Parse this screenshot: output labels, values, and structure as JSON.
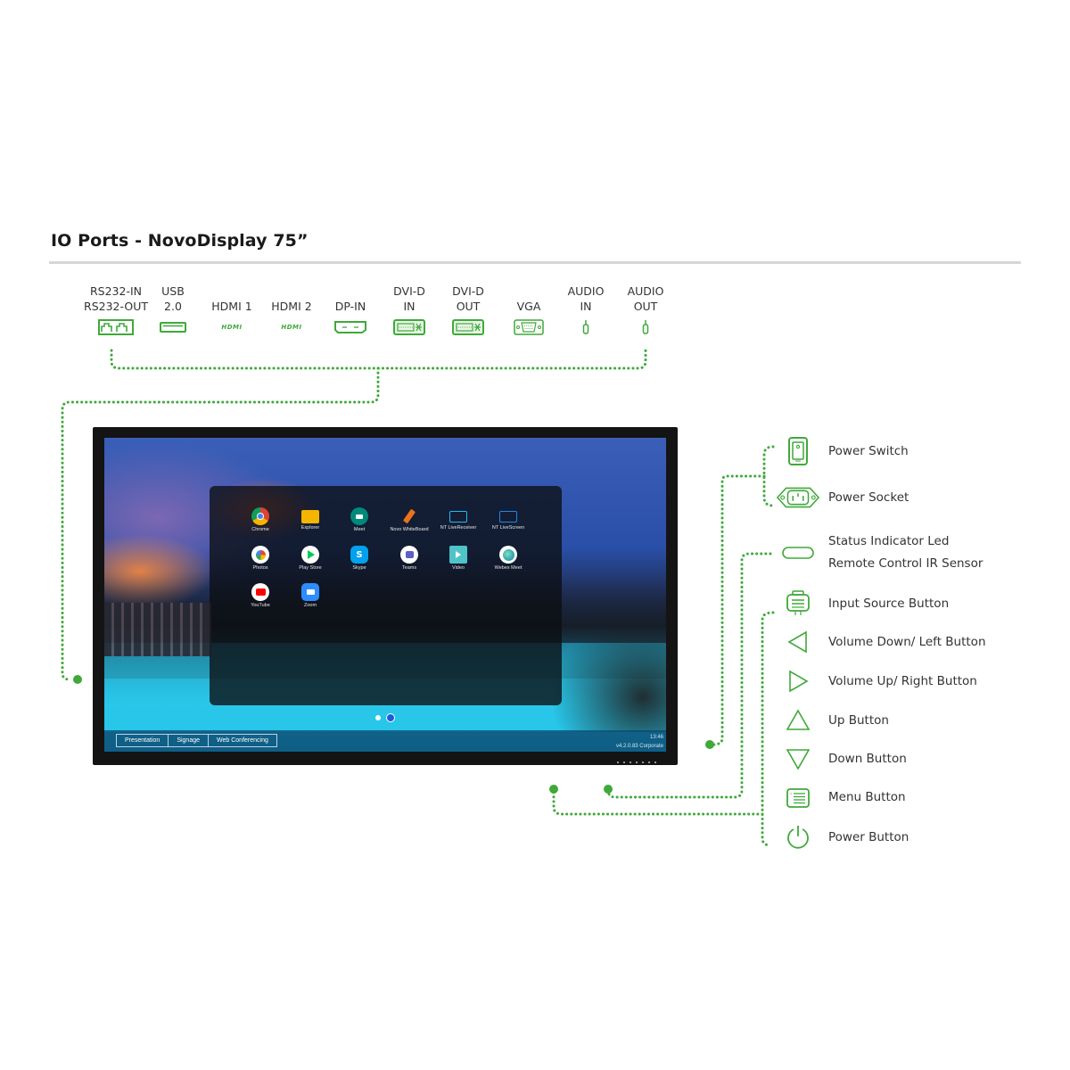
{
  "title": "IO Ports - NovoDisplay 75”",
  "accent_color": "#3fa93a",
  "ports": [
    {
      "line1": "RS232-IN",
      "line2": "RS232-OUT",
      "icon": "rj45-dual-port-icon"
    },
    {
      "line1": "USB",
      "line2": "2.0",
      "icon": "usb-port-icon"
    },
    {
      "line1": "",
      "line2": "HDMI 1",
      "icon": "hdmi-logo-icon"
    },
    {
      "line1": "",
      "line2": "HDMI 2",
      "icon": "hdmi-logo-icon"
    },
    {
      "line1": "",
      "line2": "DP-IN",
      "icon": "displayport-icon"
    },
    {
      "line1": "DVI-D",
      "line2": "IN",
      "icon": "dvi-port-icon"
    },
    {
      "line1": "DVI-D",
      "line2": "OUT",
      "icon": "dvi-port-icon"
    },
    {
      "line1": "",
      "line2": "VGA",
      "icon": "vga-port-icon"
    },
    {
      "line1": "AUDIO",
      "line2": "IN",
      "icon": "audio-jack-icon"
    },
    {
      "line1": "AUDIO",
      "line2": "OUT",
      "icon": "audio-jack-icon"
    }
  ],
  "hdmi_logo_text": "HDMI",
  "screen": {
    "apps": [
      {
        "name": "Chrome",
        "icon": "chrome-icon",
        "color": "#ffffff"
      },
      {
        "name": "Explorer",
        "icon": "folder-icon",
        "color": "#f4b400"
      },
      {
        "name": "Meet",
        "icon": "meet-icon",
        "color": "#00897b"
      },
      {
        "name": "Novo WhiteBoard",
        "icon": "marker-icon",
        "color": "#e8731a"
      },
      {
        "name": "NT LiveReceiver",
        "icon": "cast-receiver-icon",
        "color": "#29b6f6"
      },
      {
        "name": "NT LiveScreen",
        "icon": "cast-screen-icon",
        "color": "#1e88e5"
      },
      {
        "name": "Photos",
        "icon": "photos-icon",
        "color": "#ffffff"
      },
      {
        "name": "Play Store",
        "icon": "play-store-icon",
        "color": "#ffffff"
      },
      {
        "name": "Skype",
        "icon": "skype-icon",
        "color": "#00a2ed"
      },
      {
        "name": "Teams",
        "icon": "teams-icon",
        "color": "#ffffff"
      },
      {
        "name": "Video",
        "icon": "video-icon",
        "color": "#4fc3c8"
      },
      {
        "name": "Webex Meet",
        "icon": "webex-icon",
        "color": "#ffffff"
      },
      {
        "name": "YouTube",
        "icon": "youtube-icon",
        "color": "#ffffff"
      },
      {
        "name": "Zoom",
        "icon": "zoom-icon",
        "color": "#2d8cff"
      }
    ],
    "skype_glyph": "S",
    "pages": 2,
    "current_page": 2,
    "modes": [
      "Presentation",
      "Signage",
      "Web Conferencing"
    ],
    "time": "13:46",
    "version": "v4.2.0.83 Corporate"
  },
  "controls": [
    {
      "label": "Power Switch",
      "icon": "power-switch-icon"
    },
    {
      "label": "Power Socket",
      "icon": "power-socket-icon"
    },
    {
      "label": "Status Indicator Led",
      "label2": "Remote Control IR Sensor",
      "icon": "status-led-icon"
    },
    {
      "label": "Input Source Button",
      "icon": "input-source-icon"
    },
    {
      "label": "Volume Down/ Left Button",
      "icon": "triangle-left-icon"
    },
    {
      "label": "Volume Up/ Right Button",
      "icon": "triangle-right-icon"
    },
    {
      "label": "Up Button",
      "icon": "triangle-up-icon"
    },
    {
      "label": "Down Button",
      "icon": "triangle-down-icon"
    },
    {
      "label": "Menu Button",
      "icon": "menu-icon"
    },
    {
      "label": "Power Button",
      "icon": "power-icon"
    }
  ]
}
